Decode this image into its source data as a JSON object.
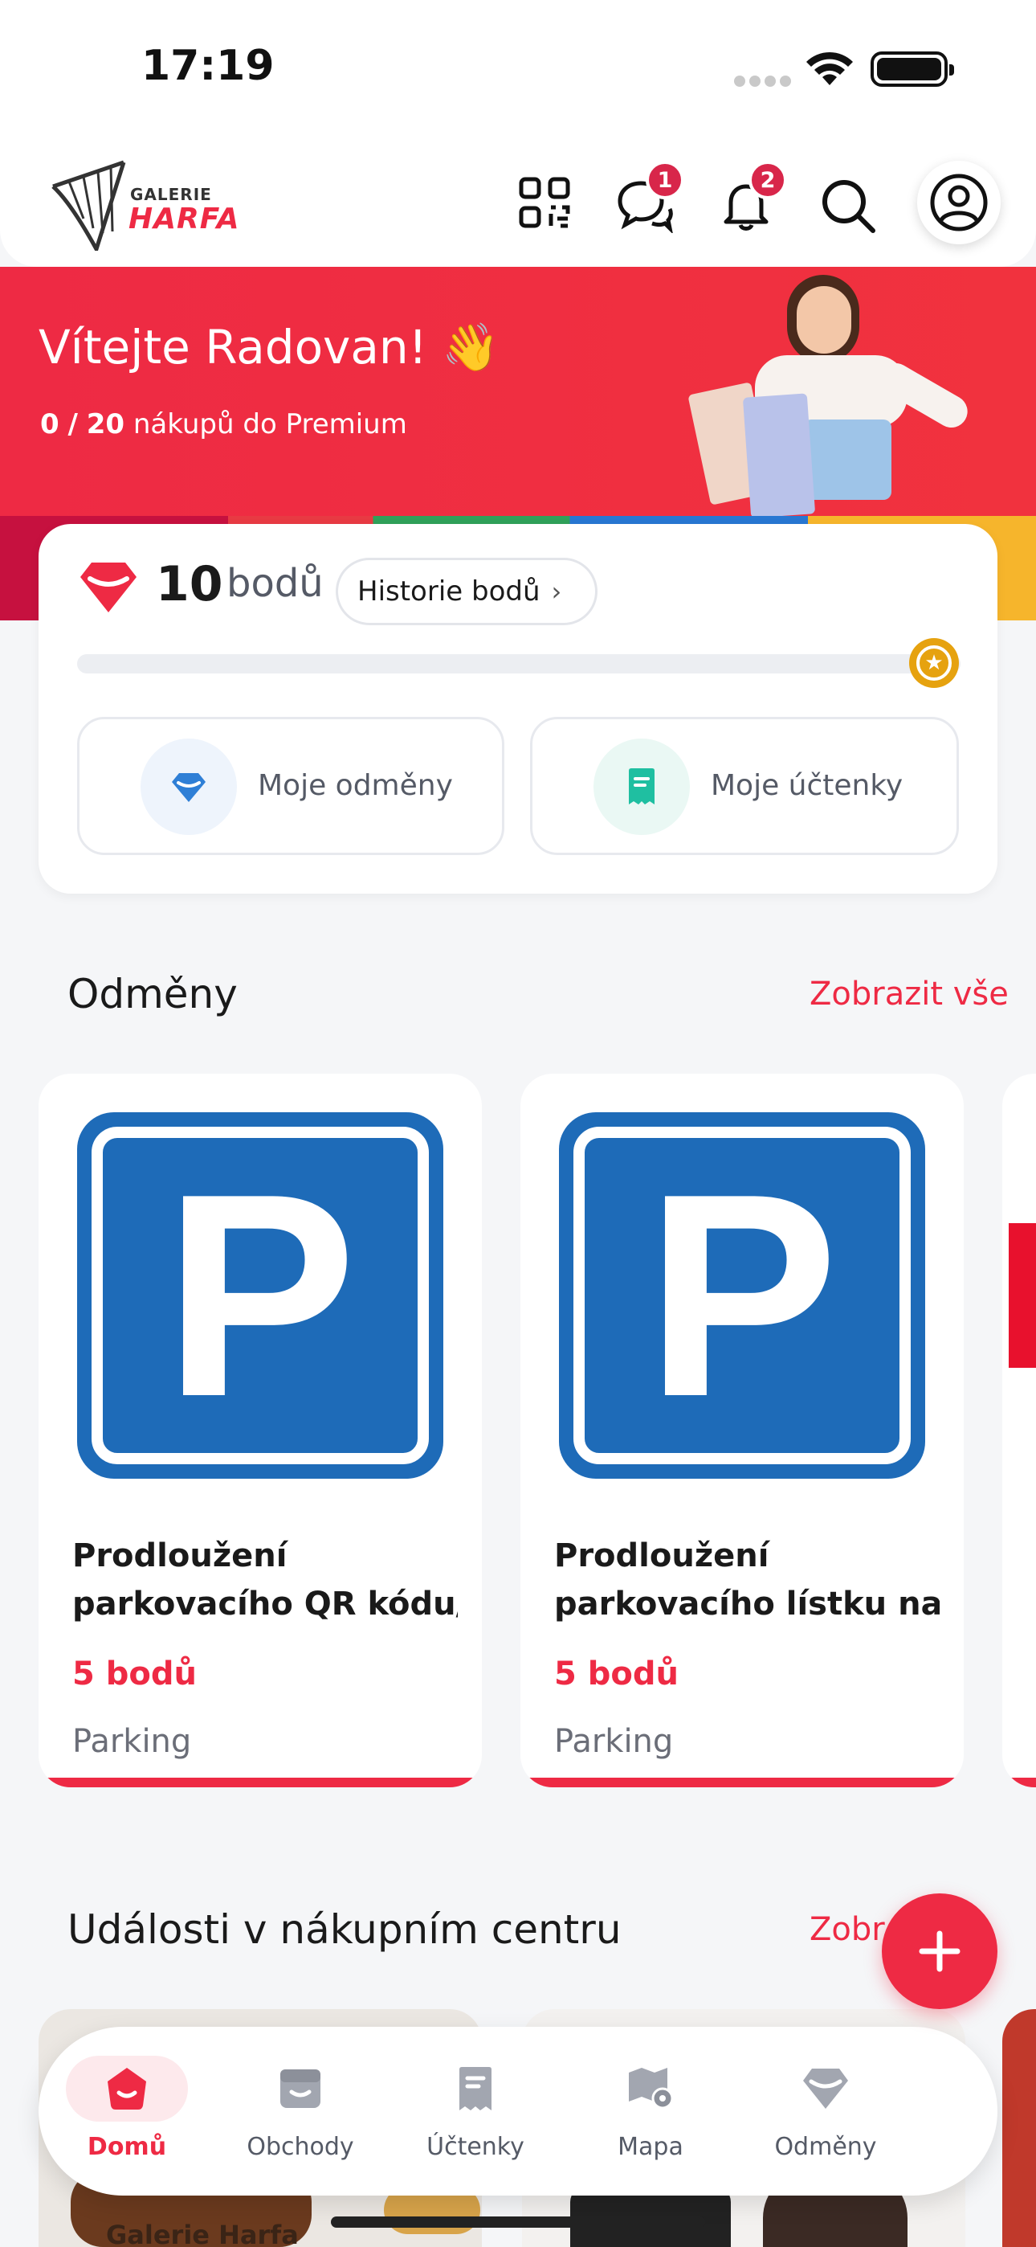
{
  "status_bar": {
    "time": "17:19"
  },
  "header": {
    "logo_top": "GALERIE",
    "logo_bottom": "HARFA",
    "chat_badge": "1",
    "notification_badge": "2"
  },
  "hero": {
    "greeting": "Vítejte Radovan! 👋",
    "premium_progress_current": "0",
    "premium_progress_separator": "/",
    "premium_progress_total": "20",
    "premium_text": "nákupů do Premium"
  },
  "points": {
    "value": "10",
    "unit": "bodů",
    "history_button": "Historie bodů",
    "progress_fraction": 0.0,
    "tile_rewards": "Moje odměny",
    "tile_receipts": "Moje účtenky"
  },
  "rewards": {
    "title": "Odměny",
    "show_all": "Zobrazit vše",
    "items": [
      {
        "title_line1": "Prodloužení",
        "title_line2": "parkovacího QR kódu/...",
        "points": "5 bodů",
        "category": "Parking",
        "icon_letter": "P"
      },
      {
        "title_line1": "Prodloužení",
        "title_line2": "parkovacího lístku na d...",
        "points": "5 bodů",
        "category": "Parking",
        "icon_letter": "P"
      }
    ]
  },
  "events": {
    "title": "Události v nákupním centru",
    "show_all": "Zobr",
    "card_text": "Galerie Harfa"
  },
  "tabbar": {
    "items": [
      {
        "label": "Domů",
        "active": true
      },
      {
        "label": "Obchody",
        "active": false
      },
      {
        "label": "Účtenky",
        "active": false
      },
      {
        "label": "Mapa",
        "active": false
      },
      {
        "label": "Odměny",
        "active": false
      }
    ]
  },
  "colors": {
    "accent": "#ee2a44",
    "parking_blue": "#1e6bb8",
    "gold": "#e6a20f"
  }
}
